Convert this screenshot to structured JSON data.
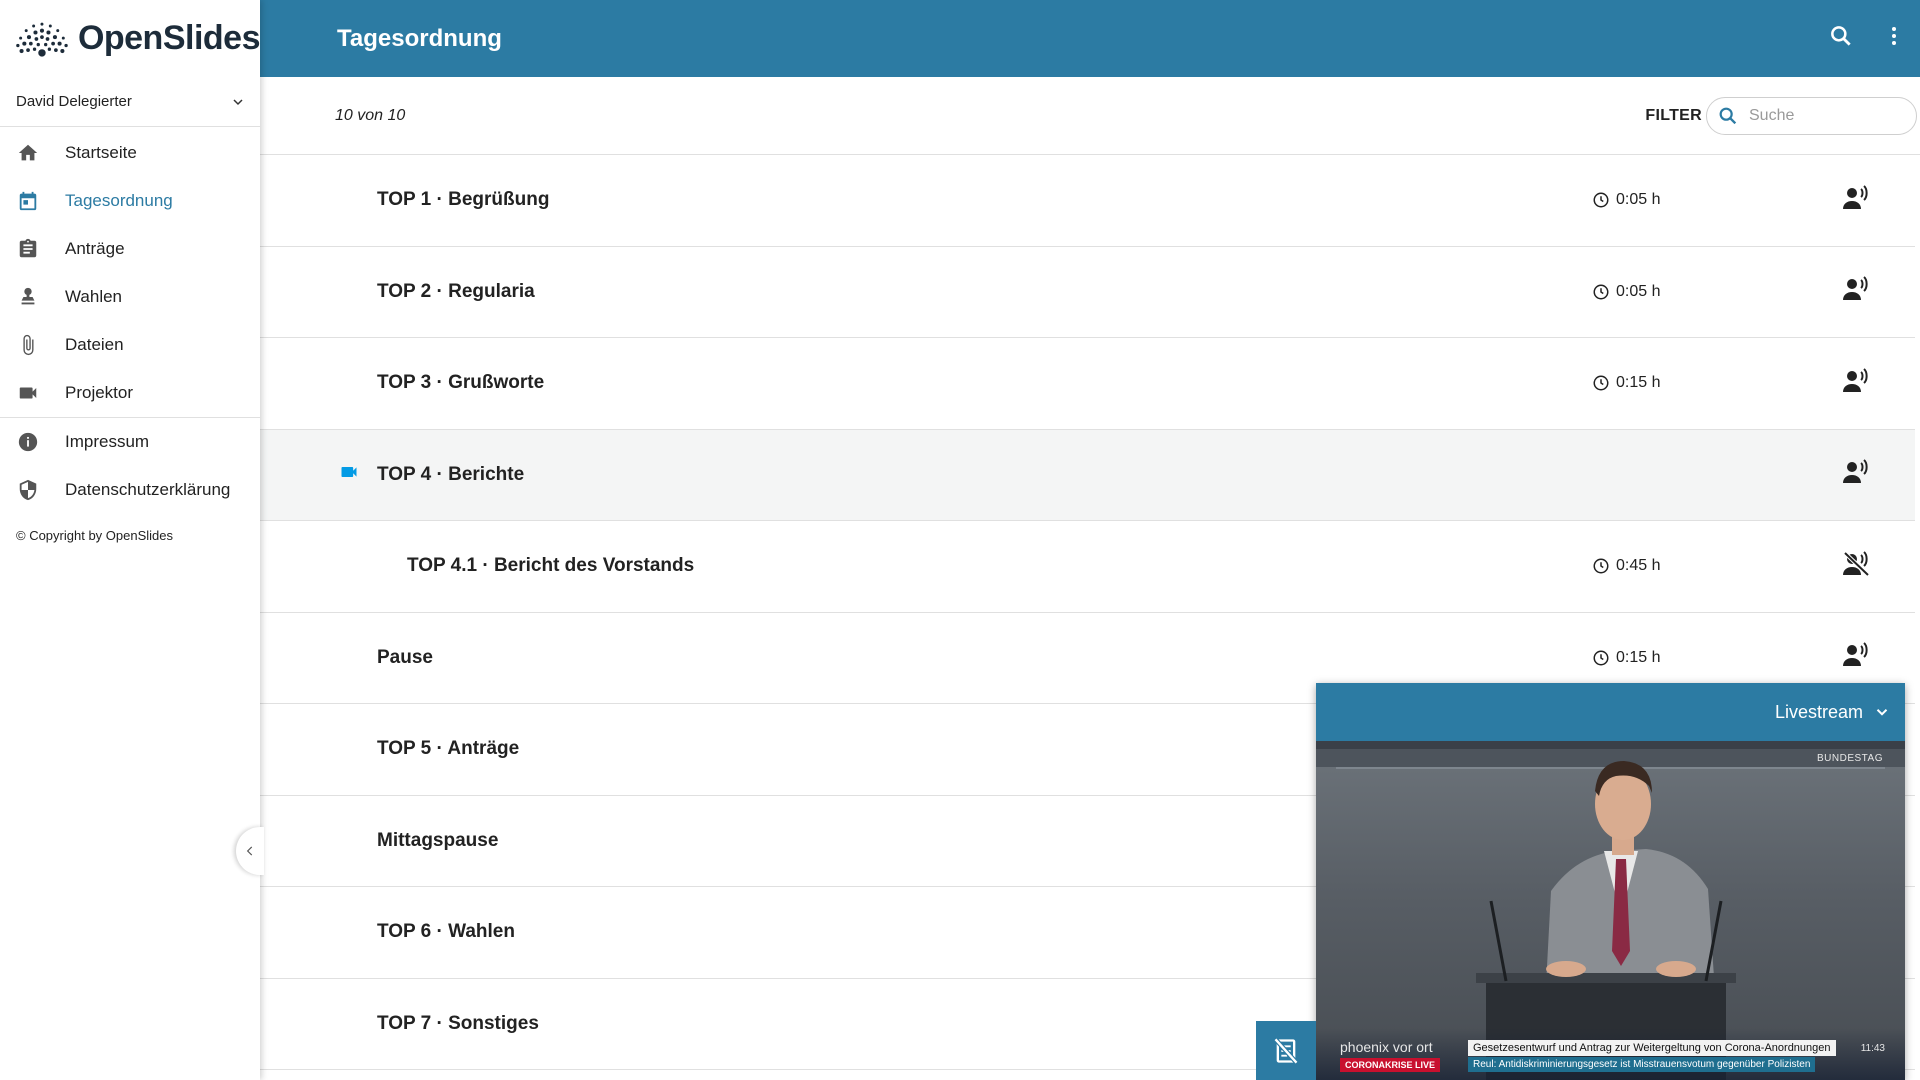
{
  "app": {
    "name": "OpenSlides"
  },
  "header": {
    "title": "Tagesordnung",
    "icons": [
      "search-icon",
      "more-vert-icon"
    ]
  },
  "user": {
    "name": "David Delegierter"
  },
  "sidebar": {
    "items": [
      {
        "label": "Startseite",
        "icon": "home-icon"
      },
      {
        "label": "Tagesordnung",
        "icon": "calendar-icon",
        "active": true
      },
      {
        "label": "Anträge",
        "icon": "assignment-icon"
      },
      {
        "label": "Wahlen",
        "icon": "vote-icon"
      },
      {
        "label": "Dateien",
        "icon": "attachment-icon"
      },
      {
        "label": "Projektor",
        "icon": "videocam-icon"
      },
      {
        "label": "Impressum",
        "icon": "info-icon"
      },
      {
        "label": "Datenschutzerklärung",
        "icon": "shield-icon"
      }
    ],
    "copyright": "© Copyright by OpenSlides"
  },
  "filterbar": {
    "count": "10 von 10",
    "filter_label": "FILTER",
    "search_placeholder": "Suche"
  },
  "agenda": [
    {
      "title": "TOP 1 · Begrüßung",
      "duration": "0:05 h",
      "speaker_icon": "speaker-icon"
    },
    {
      "title": "TOP 2 · Regularia",
      "duration": "0:05 h",
      "speaker_icon": "speaker-icon"
    },
    {
      "title": "TOP 3 · Grußworte",
      "duration": "0:15 h",
      "speaker_icon": "speaker-icon"
    },
    {
      "title": "TOP 4 · Berichte",
      "duration": "",
      "speaker_icon": "speaker-icon",
      "projected": true
    },
    {
      "title": "TOP 4.1 · Bericht des Vorstands",
      "duration": "0:45 h",
      "speaker_icon": "speaker-off-icon",
      "sub": true
    },
    {
      "title": "Pause",
      "duration": "0:15 h",
      "speaker_icon": "speaker-icon"
    },
    {
      "title": "TOP 5 · Anträge",
      "duration": "",
      "speaker_icon": ""
    },
    {
      "title": "Mittagspause",
      "duration": "",
      "speaker_icon": ""
    },
    {
      "title": "TOP 6 · Wahlen",
      "duration": "",
      "speaker_icon": ""
    },
    {
      "title": "TOP 7 · Sonstiges",
      "duration": "",
      "speaker_icon": ""
    }
  ],
  "livestream": {
    "title": "Livestream",
    "channel_badge": "BUNDESTAG",
    "brand": "phoenix vor ort",
    "brand_sub": "CORONAKRISE LIVE",
    "caption_line1": "Gesetzesentwurf und Antrag zur Weitergeltung von Corona-Anordnungen",
    "caption_line2": "Reul: Antidiskriminierungsgesetz ist Misstrauensvotum gegenüber Polizisten",
    "time": "11:43"
  },
  "colors": {
    "primary": "#2c7ba3",
    "projector_accent": "#039be5"
  }
}
